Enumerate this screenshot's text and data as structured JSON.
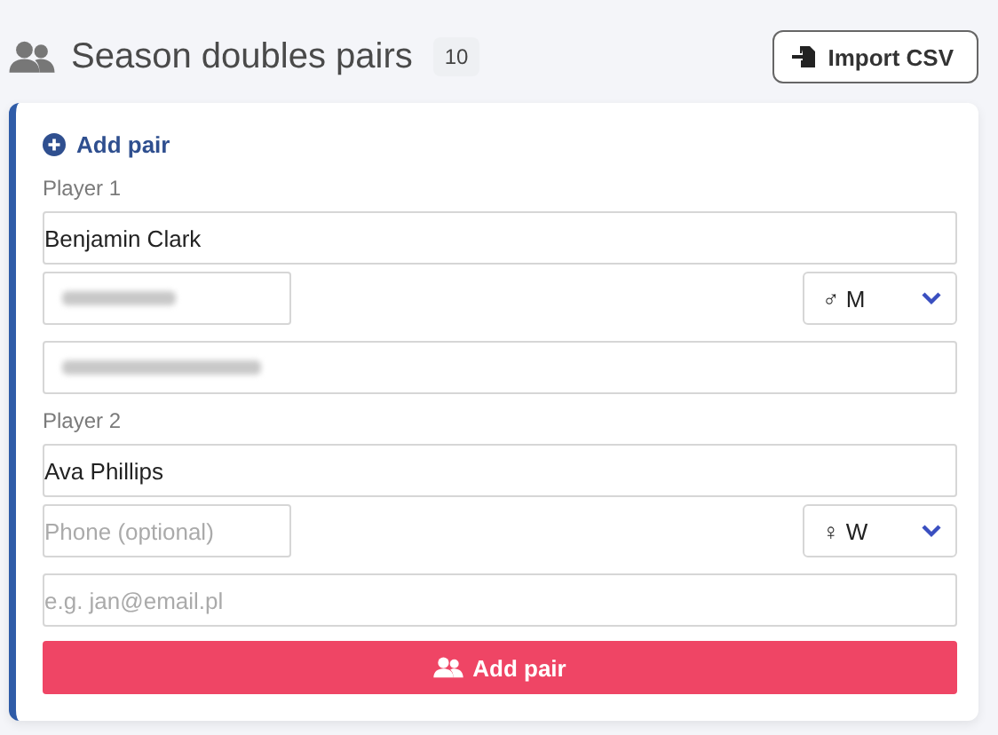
{
  "header": {
    "title": "Season doubles pairs",
    "count": "10",
    "import_button": "Import CSV"
  },
  "card": {
    "heading": "Add pair",
    "players": [
      {
        "label": "Player 1",
        "name": {
          "value": "Benjamin Clark"
        },
        "phone": {
          "redacted": true
        },
        "gender": {
          "symbol": "♂",
          "value": "M"
        },
        "email": {
          "redacted": true
        }
      },
      {
        "label": "Player 2",
        "name": {
          "value": "Ava Phillips"
        },
        "phone": {
          "placeholder": "Phone (optional)",
          "redacted": false
        },
        "gender": {
          "symbol": "♀",
          "value": "W"
        },
        "email": {
          "placeholder": "e.g. jan@email.pl",
          "redacted": false
        }
      }
    ],
    "submit": "Add pair"
  }
}
